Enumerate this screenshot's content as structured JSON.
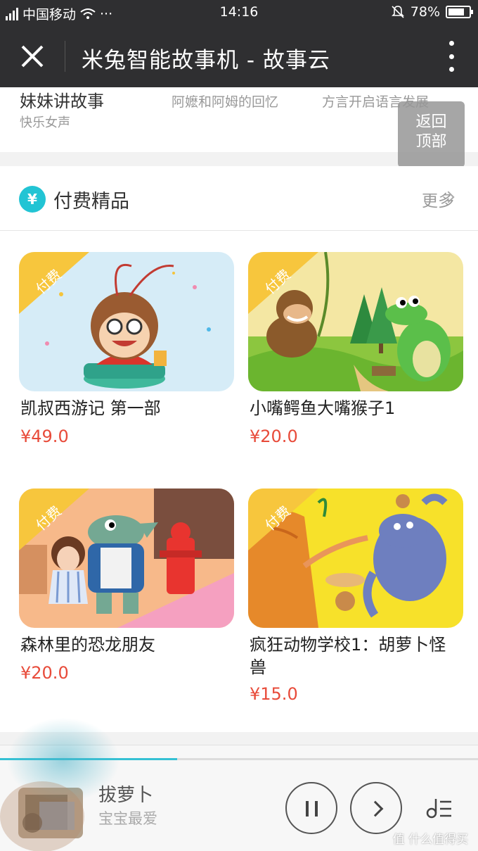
{
  "status_bar": {
    "carrier": "中国移动",
    "time": "14:16",
    "battery": "78%"
  },
  "title_bar": {
    "title": "米兔智能故事机 - 故事云"
  },
  "top_strip": {
    "item1_title": "妹妹讲故事",
    "item1_sub": "快乐女声",
    "item2_title": "阿嬷和阿姆的回忆",
    "item3_title": "方言开启语言发展"
  },
  "back_to_top": {
    "line1": "返回",
    "line2": "顶部"
  },
  "paid_section": {
    "badge": "¥",
    "title": "付费精品",
    "more": "更多",
    "tag": "付费",
    "items": [
      {
        "name": "凯叔西游记 第一部",
        "price": "¥49.0"
      },
      {
        "name": "小嘴鳄鱼大嘴猴子1",
        "price": "¥20.0"
      },
      {
        "name": "森林里的恐龙朋友",
        "price": "¥20.0"
      },
      {
        "name": "疯狂动物学校1：胡萝卜怪兽",
        "price": "¥15.0"
      }
    ]
  },
  "player": {
    "track_title": "拔萝卜",
    "track_subtitle": "宝宝最爱",
    "progress": 0.37
  },
  "watermark": "值 什么值得买",
  "colors": {
    "accent": "#22c4d4",
    "price": "#e84b3a",
    "bar": "#2f2f31"
  }
}
